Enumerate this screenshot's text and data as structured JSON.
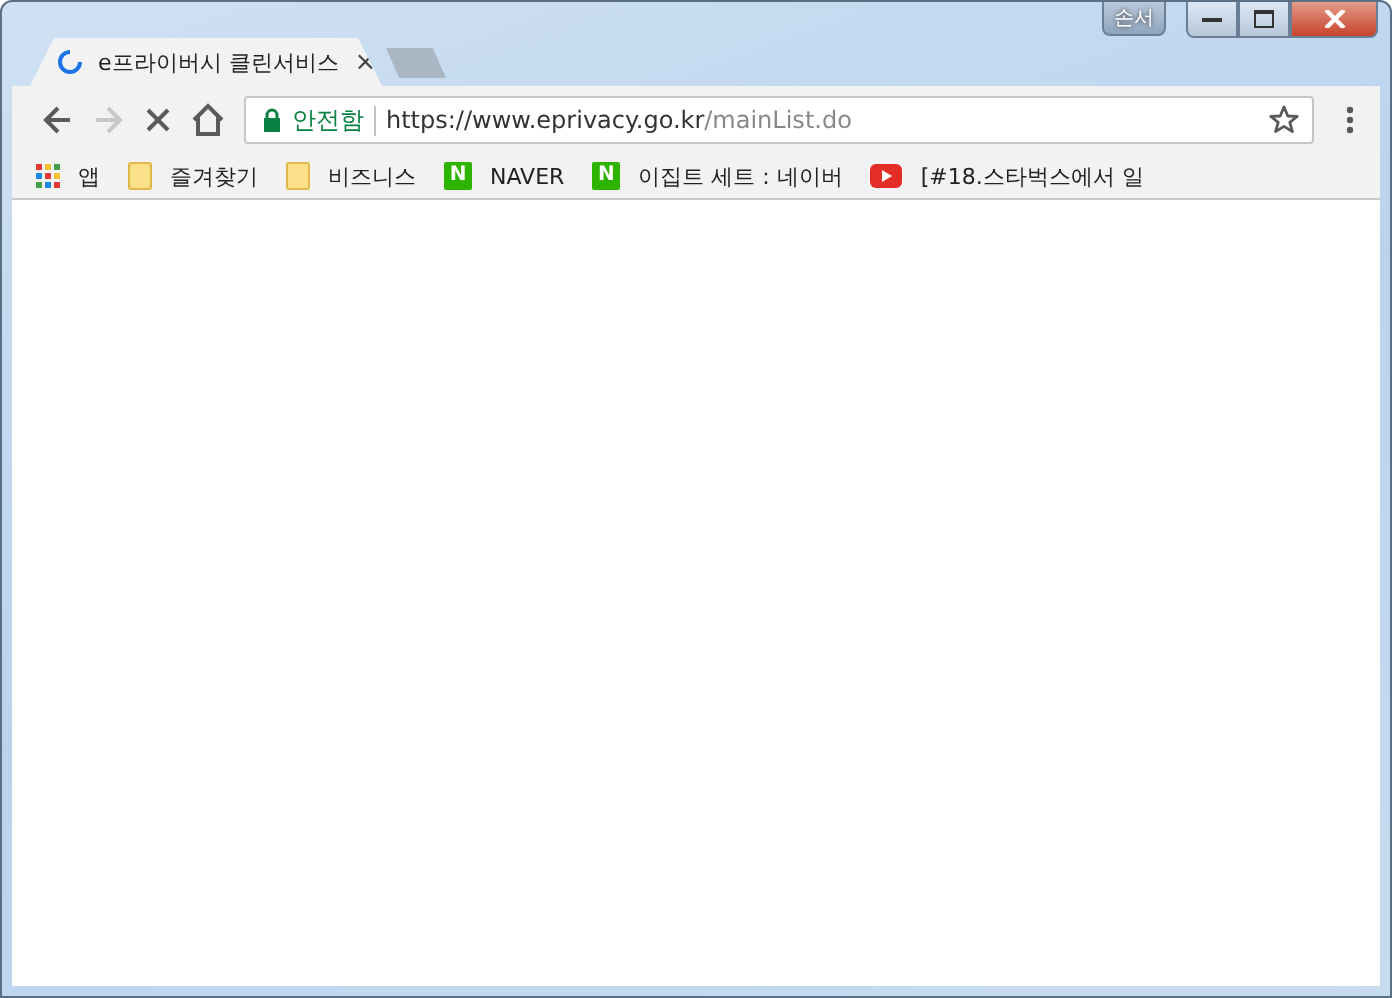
{
  "window": {
    "profile_button": "손서"
  },
  "tabs": [
    {
      "title": "e프라이버시 클린서비스",
      "selected": true,
      "loading": true,
      "close": "×"
    }
  ],
  "navigation": {
    "back_disabled": false,
    "forward_disabled": true,
    "loading": true
  },
  "address_bar": {
    "secure": true,
    "security_label": "안전함",
    "url_host": "https://www.eprivacy.go.kr",
    "url_path": "/mainList.do",
    "bookmarked": false
  },
  "bookmarks": [
    {
      "kind": "apps",
      "label": "앱"
    },
    {
      "kind": "folder",
      "label": "즐겨찾기"
    },
    {
      "kind": "folder",
      "label": "비즈니스"
    },
    {
      "kind": "badge",
      "badge": "N",
      "label": "NAVER"
    },
    {
      "kind": "badge",
      "badge": "N",
      "label": "이집트 세트 : 네이버"
    },
    {
      "kind": "youtube",
      "label": "[#18.스타벅스에서 일"
    }
  ]
}
